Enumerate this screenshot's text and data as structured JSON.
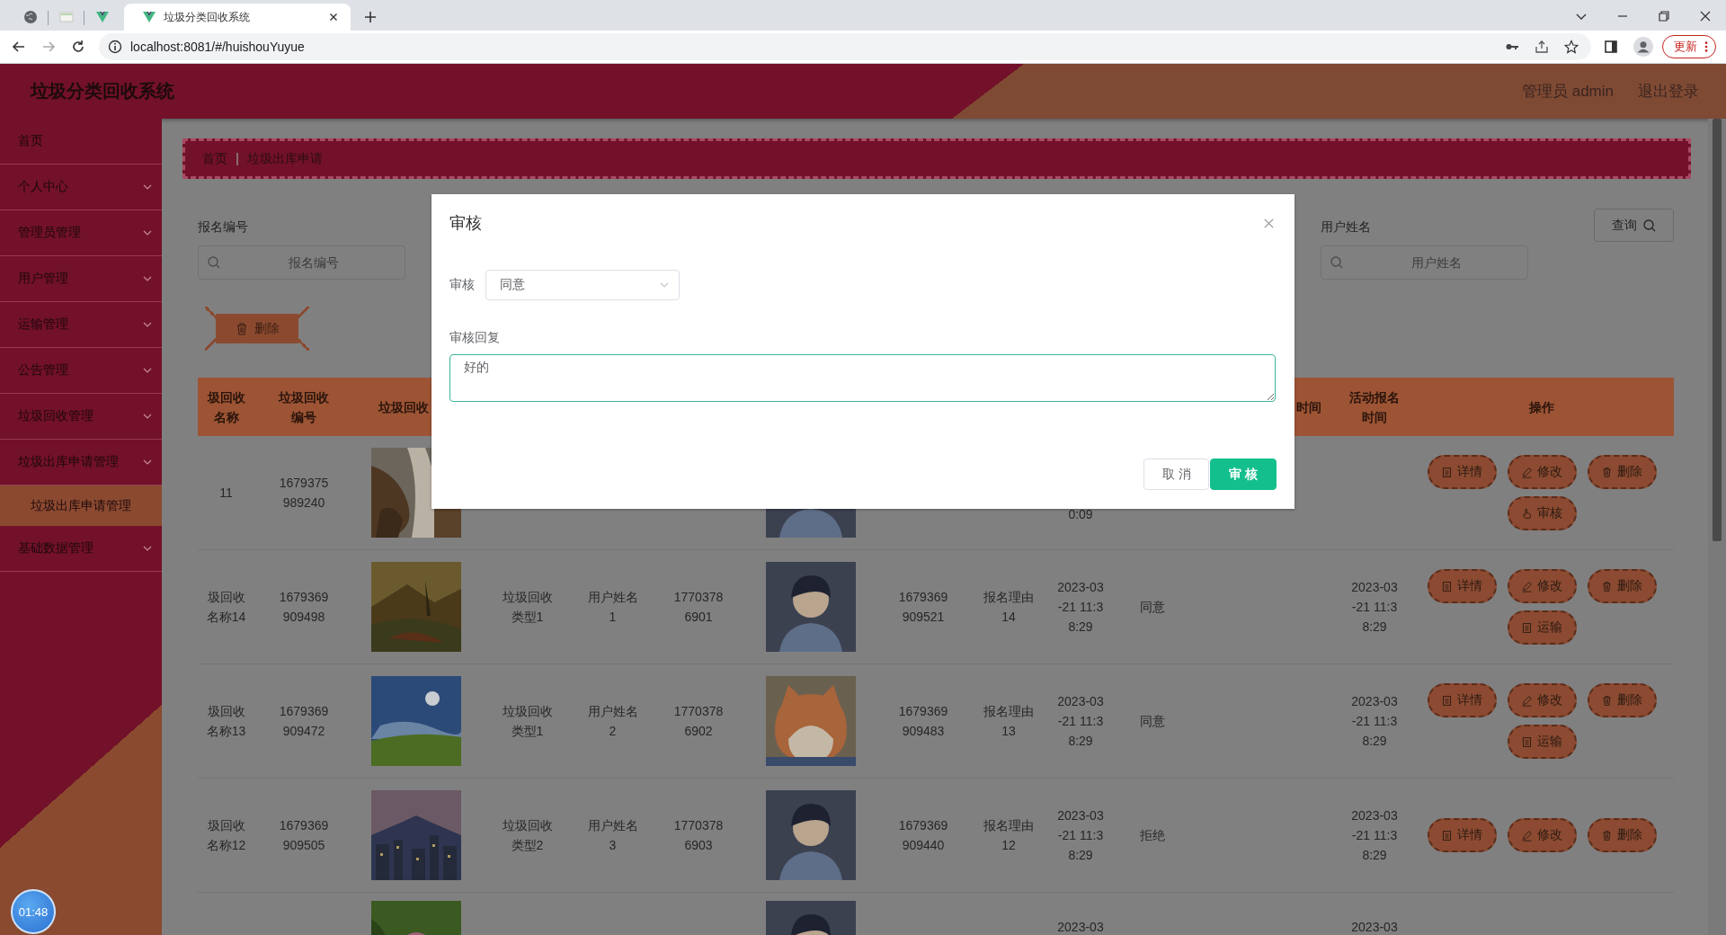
{
  "browser": {
    "tabs": [
      {
        "kind": "globe",
        "selected": false
      },
      {
        "kind": "page",
        "selected": false
      },
      {
        "kind": "vue",
        "selected": false
      },
      {
        "kind": "vue",
        "title": "垃圾分类回收系统",
        "selected": true
      }
    ],
    "url": "localhost:8081/#/huishouYuyue",
    "update_button": "更新"
  },
  "header": {
    "title": "垃圾分类回收系统",
    "user": "管理员 admin",
    "logout": "退出登录"
  },
  "sidebar": {
    "items": [
      {
        "label": "首页",
        "kind": "link"
      },
      {
        "label": "个人中心",
        "kind": "menu"
      },
      {
        "label": "管理员管理",
        "kind": "menu"
      },
      {
        "label": "用户管理",
        "kind": "menu"
      },
      {
        "label": "运输管理",
        "kind": "menu"
      },
      {
        "label": "公告管理",
        "kind": "menu"
      },
      {
        "label": "垃圾回收管理",
        "kind": "menu"
      },
      {
        "label": "垃圾出库申请管理",
        "kind": "menu",
        "children": [
          {
            "label": "垃圾出库申请管理",
            "selected": true
          }
        ]
      },
      {
        "label": "基础数据管理",
        "kind": "menu"
      }
    ]
  },
  "breadcrumb": [
    "首页",
    "垃圾出库申请"
  ],
  "search": {
    "fields": [
      {
        "label": "报名编号",
        "placeholder": "报名编号"
      },
      {
        "label": "用户姓名",
        "placeholder": "用户姓名"
      }
    ],
    "button": "查询"
  },
  "delete_button": "删除",
  "table": {
    "columns": [
      "圾回收名称",
      "垃圾回收编号",
      "垃圾回收",
      null,
      null,
      null,
      null,
      null,
      null,
      null,
      null,
      "时间",
      "活动报名时间",
      "操作"
    ],
    "rows": [
      {
        "cells": [
          "11",
          "1679375989240",
          {
            "kind": "picture"
          },
          null,
          null,
          null,
          {
            "kind": "picture"
          },
          null,
          null,
          "0:09",
          null,
          null,
          null
        ],
        "actions": [
          {
            "kind": "detail",
            "label": "详情"
          },
          {
            "kind": "edit",
            "label": "修改"
          },
          {
            "kind": "delete",
            "label": "删除"
          },
          {
            "kind": "audit",
            "label": "审核"
          }
        ]
      },
      {
        "cells": [
          "圾回收名称14",
          "1679369909498",
          {
            "kind": "picture"
          },
          "垃圾回收类型1",
          "用户姓名1",
          "17703786901",
          {
            "kind": "picture"
          },
          "1679369909521",
          "报名理由14",
          "2023-03-21 11:38:29",
          "同意",
          null,
          "2023-03-21 11:38:29"
        ],
        "actions": [
          {
            "kind": "detail",
            "label": "详情"
          },
          {
            "kind": "edit",
            "label": "修改"
          },
          {
            "kind": "delete",
            "label": "删除"
          },
          {
            "kind": "transport",
            "label": "运输"
          }
        ]
      },
      {
        "cells": [
          "圾回收名称13",
          "1679369909472",
          {
            "kind": "picture"
          },
          "垃圾回收类型1",
          "用户姓名2",
          "17703786902",
          {
            "kind": "picture"
          },
          "1679369909483",
          "报名理由13",
          "2023-03-21 11:38:29",
          "同意",
          null,
          "2023-03-21 11:38:29"
        ],
        "actions": [
          {
            "kind": "detail",
            "label": "详情"
          },
          {
            "kind": "edit",
            "label": "修改"
          },
          {
            "kind": "delete",
            "label": "删除"
          },
          {
            "kind": "transport",
            "label": "运输"
          }
        ]
      },
      {
        "cells": [
          "圾回收名称12",
          "1679369909505",
          {
            "kind": "picture"
          },
          "垃圾回收类型2",
          "用户姓名3",
          "17703786903",
          {
            "kind": "picture"
          },
          "1679369909440",
          "报名理由12",
          "2023-03-21 11:38:29",
          "拒绝",
          null,
          "2023-03-21 11:38:29"
        ],
        "actions": [
          {
            "kind": "detail",
            "label": "详情"
          },
          {
            "kind": "edit",
            "label": "修改"
          },
          {
            "kind": "delete",
            "label": "删除"
          }
        ]
      },
      {
        "cells": [
          null,
          null,
          {
            "kind": "picture"
          },
          null,
          null,
          null,
          {
            "kind": "picture"
          },
          null,
          null,
          "2023-03",
          null,
          null,
          "2023-03"
        ]
      }
    ]
  },
  "dialog": {
    "title": "审核",
    "fields": [
      {
        "kind": "select",
        "label": "审核",
        "value": "同意"
      },
      {
        "kind": "textarea",
        "label": "审核回复",
        "value": "好的"
      }
    ],
    "buttons": [
      {
        "kind": "cancel",
        "label": "取消"
      },
      {
        "kind": "primary",
        "label": "审核"
      }
    ]
  },
  "recorder_timer": "01:48"
}
